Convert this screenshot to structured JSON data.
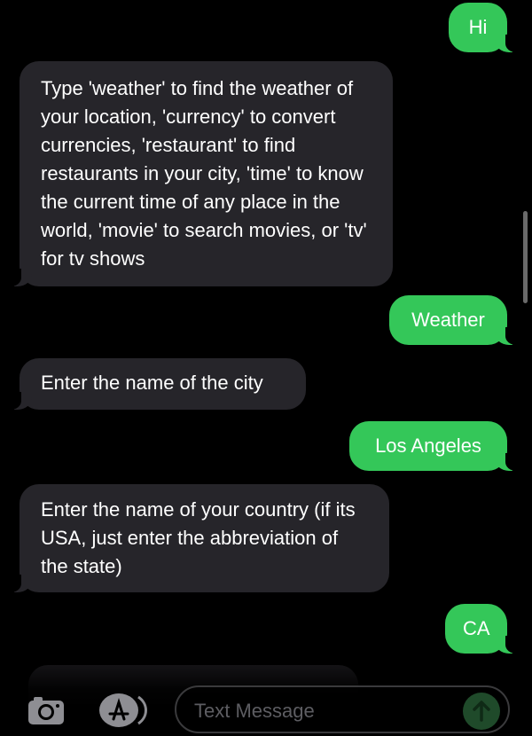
{
  "messages": [
    {
      "direction": "outgoing",
      "text": "Hi"
    },
    {
      "direction": "incoming",
      "text": "Type 'weather' to find the weather of your location, 'currency' to convert currencies, 'restaurant' to find restaurants in your city, 'time' to know the current time of any place in the world, 'movie' to search movies, or 'tv' for tv shows"
    },
    {
      "direction": "outgoing",
      "text": "Weather"
    },
    {
      "direction": "incoming",
      "text": "Enter the name of the city"
    },
    {
      "direction": "outgoing",
      "text": "Los Angeles"
    },
    {
      "direction": "incoming",
      "text": "Enter the name of your country (if its USA, just enter the abbreviation of the state)"
    },
    {
      "direction": "outgoing",
      "text": "CA"
    }
  ],
  "composer": {
    "placeholder": "Text Message",
    "camera_icon": "camera-icon",
    "appstore_icon": "app-store-icon",
    "send_icon": "arrow-up-icon"
  },
  "colors": {
    "outgoing_bubble": "#34c759",
    "incoming_bubble": "#26252a",
    "background": "#000000"
  }
}
